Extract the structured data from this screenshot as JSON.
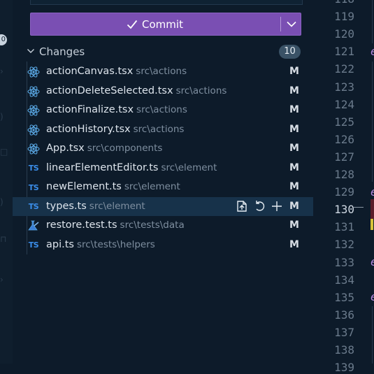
{
  "activity_bar": {
    "badge": "0"
  },
  "commit": {
    "label": "Commit",
    "check_icon": "check-icon",
    "dropdown_icon": "chevron-down-icon"
  },
  "changes": {
    "label": "Changes",
    "count": "10"
  },
  "files": [
    {
      "name": "actionCanvas.tsx",
      "path": "src\\actions",
      "status": "M",
      "icon": "react-icon"
    },
    {
      "name": "actionDeleteSelected.tsx",
      "path": "src\\actions",
      "status": "M",
      "icon": "react-icon"
    },
    {
      "name": "actionFinalize.tsx",
      "path": "src\\actions",
      "status": "M",
      "icon": "react-icon"
    },
    {
      "name": "actionHistory.tsx",
      "path": "src\\actions",
      "status": "M",
      "icon": "react-icon"
    },
    {
      "name": "App.tsx",
      "path": "src\\components",
      "status": "M",
      "icon": "react-icon"
    },
    {
      "name": "linearElementEditor.ts",
      "path": "src\\element",
      "status": "M",
      "icon": "typescript-icon",
      "icon_text": "TS"
    },
    {
      "name": "newElement.ts",
      "path": "src\\element",
      "status": "M",
      "icon": "typescript-icon",
      "icon_text": "TS"
    },
    {
      "name": "types.ts",
      "path": "src\\element",
      "status": "M",
      "icon": "typescript-icon",
      "icon_text": "TS",
      "selected": true
    },
    {
      "name": "restore.test.ts",
      "path": "src\\tests\\data",
      "status": "M",
      "icon": "test-flask-icon"
    },
    {
      "name": "api.ts",
      "path": "src\\tests\\helpers",
      "status": "M",
      "icon": "typescript-icon",
      "icon_text": "TS"
    }
  ],
  "row_actions": [
    "open-file-icon",
    "discard-changes-icon",
    "stage-changes-icon"
  ],
  "editor": {
    "line_numbers": [
      "118",
      "119",
      "120",
      "121",
      "122",
      "123",
      "124",
      "125",
      "126",
      "127",
      "128",
      "129",
      "130",
      "131",
      "132",
      "133",
      "134",
      "135",
      "136",
      "137",
      "138",
      "139"
    ],
    "active_line": "130",
    "gutter_glyph": "e"
  },
  "colors": {
    "commit_button": "#7a4fb3",
    "selected_row": "#17324a",
    "background": "#0d1b2a",
    "ts_blue": "#3b8eea",
    "react_blue": "#5aa9e6"
  }
}
